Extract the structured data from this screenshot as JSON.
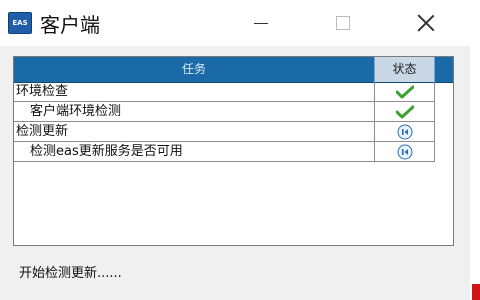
{
  "window": {
    "icon_text": "EAS",
    "title": "客户端"
  },
  "table": {
    "headers": {
      "task": "任务",
      "status": "状态"
    },
    "rows": [
      {
        "task": "环境检查",
        "indent": 0,
        "status_icon": "check-icon"
      },
      {
        "task": "客户端环境检测",
        "indent": 1,
        "status_icon": "check-icon"
      },
      {
        "task": "检测更新",
        "indent": 0,
        "status_icon": "info-icon"
      },
      {
        "task": "检测eas更新服务是否可用",
        "indent": 1,
        "status_icon": "info-icon"
      }
    ]
  },
  "status": {
    "text": "开始检测更新......"
  },
  "colors": {
    "header_blue": "#1a6aa8",
    "check_green": "#3aa12f",
    "info_blue": "#2b6fb3"
  }
}
